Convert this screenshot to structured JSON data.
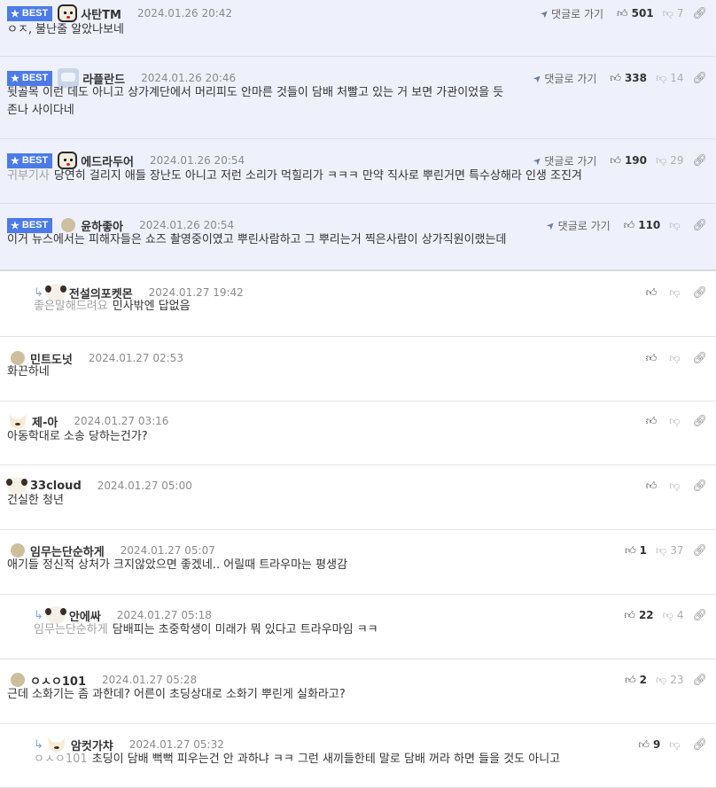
{
  "labels": {
    "best": "BEST",
    "reply": "댓글로 가기"
  },
  "colors": {
    "best_badge": "#4c7be8",
    "best_background": "#eef1fb"
  },
  "comments": [
    {
      "best": true,
      "reply": false,
      "avatar": "bear-icon",
      "nick": "사탄TM",
      "time": "2024.01.26 20:42",
      "mention": "",
      "text": "ㅇㅈ, 불난줄 알았나보네",
      "up": "501",
      "down": "7",
      "show_reply_link": true
    },
    {
      "best": true,
      "reply": false,
      "avatar": "robot-icon",
      "nick": "라플란드",
      "time": "2024.01.26 20:46",
      "mention": "",
      "text": "뒷골목 이런 데도 아니고 상가계단에서 머리피도 안마른 것들이 담배 처빨고 있는 거 보면 가관이었을 듯",
      "text2": "존나 사이다네",
      "up": "338",
      "down": "14",
      "show_reply_link": true
    },
    {
      "best": true,
      "reply": false,
      "avatar": "bear-icon",
      "nick": "에드라두어",
      "time": "2024.01.26 20:54",
      "mention": "귀부기사",
      "text": "당연히 걸리지 애들 장난도 아니고 저런 소리가 먹힐리가 ㅋㅋㅋ 만약 직사로 뿌린거면 특수상해라 인생 조진겨",
      "up": "190",
      "down": "29",
      "show_reply_link": true
    },
    {
      "best": true,
      "reply": false,
      "avatar": "round-avatar",
      "nick": "윤하좋아",
      "time": "2024.01.26 20:54",
      "mention": "",
      "text": "이거 뉴스에서는 피해자들은 쇼즈 촬영중이였고 뿌린사람하고 그 뿌리는거 찍은사람이 상가직원이랬는데",
      "up": "110",
      "down": "",
      "show_reply_link": true
    },
    {
      "best": false,
      "reply": true,
      "avatar": "dog-icon",
      "nick": "전설의포켓몬",
      "time": "2024.01.27 19:42",
      "mention": "좋은말해드려요",
      "text": "민사밖엔 답없음",
      "up": "",
      "down": "",
      "show_reply_link": false
    },
    {
      "best": false,
      "reply": false,
      "avatar": "round-avatar",
      "nick": "민트도넛",
      "time": "2024.01.27 02:53",
      "mention": "",
      "text": "화끈하네",
      "up": "",
      "down": "",
      "show_reply_link": false
    },
    {
      "best": false,
      "reply": false,
      "avatar": "fox-icon",
      "nick": "제-아",
      "time": "2024.01.27 03:16",
      "mention": "",
      "text": "아동학대로 소송 당하는건가?",
      "up": "",
      "down": "",
      "show_reply_link": false
    },
    {
      "best": false,
      "reply": false,
      "avatar": "dog-icon",
      "nick": "33cloud",
      "time": "2024.01.27 05:00",
      "mention": "",
      "text": "건실한 청년",
      "up": "",
      "down": "",
      "show_reply_link": false
    },
    {
      "best": false,
      "reply": false,
      "avatar": "round-avatar",
      "nick": "임무는단순하게",
      "time": "2024.01.27 05:07",
      "mention": "",
      "text": "애기들 정신적 상처가 크지않았으면 좋겠네.. 어릴때 트라우마는 평생감",
      "up": "1",
      "down": "37",
      "show_reply_link": false
    },
    {
      "best": false,
      "reply": true,
      "avatar": "dog-icon",
      "nick": "안에싸",
      "time": "2024.01.27 05:18",
      "mention": "임무는단순하게",
      "text": "담배피는 초중학생이 미래가 뭐 있다고 트라우마임 ㅋㅋ",
      "up": "22",
      "down": "4",
      "show_reply_link": false
    },
    {
      "best": false,
      "reply": false,
      "avatar": "round-avatar",
      "nick": "ㅇㅅㅇ101",
      "time": "2024.01.27 05:28",
      "mention": "",
      "text": "근데 소화기는 좀 과한데? 어른이 초딩상대로 소화기 뿌린게 실화라고?",
      "up": "2",
      "down": "23",
      "show_reply_link": false
    },
    {
      "best": false,
      "reply": true,
      "avatar": "fox-icon",
      "nick": "암컷가챠",
      "time": "2024.01.27 05:32",
      "mention": "ㅇㅅㅇ101",
      "text": "초딩이 담배 뻑뻑 피우는건 안 과하냐 ㅋㅋ 그런 새끼들한테 말로 담배 꺼라 하면 들을 것도 아니고",
      "up": "9",
      "down": "",
      "show_reply_link": false
    }
  ]
}
